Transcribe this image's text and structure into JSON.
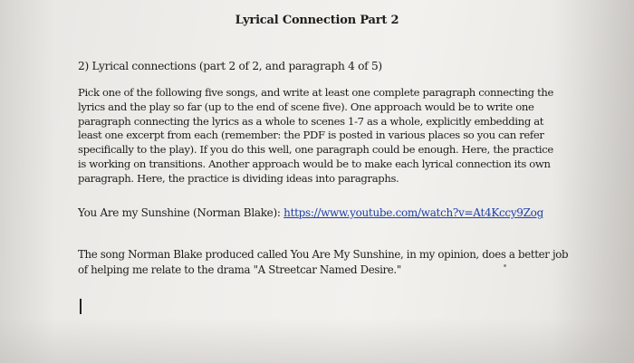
{
  "document": {
    "title": "Lyrical Connection Part 2",
    "question": "2) Lyrical connections (part 2 of 2, and paragraph 4 of 5)",
    "prompt": "Pick one of the following five songs, and write at least one complete paragraph connecting the lyrics and the play so far (up to the end of scene five). One approach would be to write one paragraph connecting the lyrics as a whole to scenes 1-7 as a whole, explicitly embedding at least one excerpt from each (remember: the PDF is posted in various places so you can refer specifically to the play). If you do this well, one paragraph could be enough. Here, the practice is working on transitions. Another approach would be to make each lyrical connection its own paragraph. Here, the practice is dividing ideas into paragraphs.",
    "song_label": "You Are my Sunshine (Norman Blake):",
    "song_url": "https://www.youtube.com/watch?v=At4Kccy9Zog",
    "answer": "The song Norman Blake produced called You Are My Sunshine, in my opinion, does a better job of helping me relate to the drama \"A Streetcar Named Desire.\""
  }
}
